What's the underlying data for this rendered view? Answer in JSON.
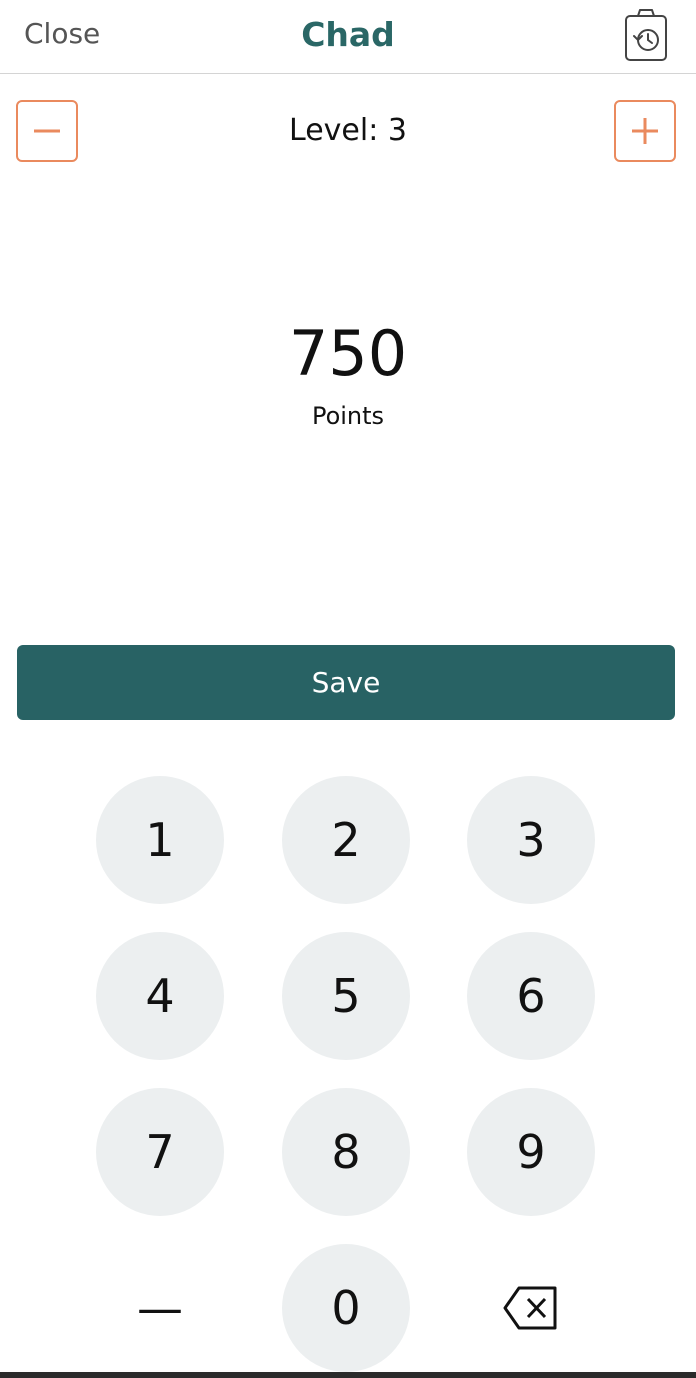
{
  "header": {
    "close_label": "Close",
    "title": "Chad",
    "history_icon": "clipboard-history-icon"
  },
  "level": {
    "label": "Level: 3",
    "minus_icon": "minus-icon",
    "plus_icon": "plus-icon"
  },
  "points": {
    "value": "750",
    "label": "Points"
  },
  "save_label": "Save",
  "keypad": {
    "keys": [
      "1",
      "2",
      "3",
      "4",
      "5",
      "6",
      "7",
      "8",
      "9",
      "—",
      "0"
    ],
    "backspace_icon": "backspace-icon"
  },
  "colors": {
    "accent_teal": "#2a6766",
    "accent_orange": "#ea8a5e",
    "key_background": "#eceff0"
  }
}
